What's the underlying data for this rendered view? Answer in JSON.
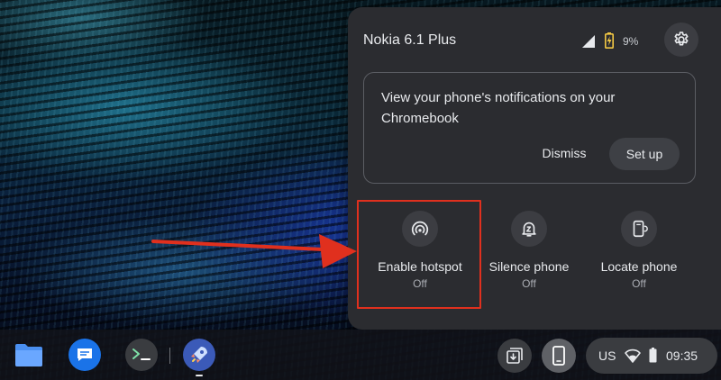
{
  "colors": {
    "panel_bg": "#2b2c30",
    "accent_highlight": "#e0301e",
    "battery_charging": "#f2c744",
    "text_primary": "#e8eaed",
    "text_secondary": "#a9acb2"
  },
  "phone_hub": {
    "device_name": "Nokia 6.1 Plus",
    "signal_icon": "cell-signal-icon",
    "battery_icon": "battery-charging-icon",
    "battery_percent": "9%",
    "settings_icon": "gear-icon",
    "notification_card": {
      "message": "View your phone's notifications on your Chromebook",
      "dismiss_label": "Dismiss",
      "setup_label": "Set up"
    },
    "features": [
      {
        "label": "Enable hotspot",
        "state": "Off",
        "icon": "hotspot-icon"
      },
      {
        "label": "Silence phone",
        "state": "Off",
        "icon": "silence-bell-icon"
      },
      {
        "label": "Locate phone",
        "state": "Off",
        "icon": "locate-phone-icon"
      }
    ]
  },
  "shelf": {
    "apps": [
      {
        "name": "Files",
        "icon": "folder-icon"
      },
      {
        "name": "Messages",
        "icon": "messages-icon"
      },
      {
        "name": "Terminal",
        "icon": "terminal-icon"
      },
      {
        "name": "Launcher app",
        "icon": "rocket-icon"
      }
    ],
    "tray": {
      "holding_space_icon": "holding-space-icon",
      "phone_hub_icon": "phone-icon",
      "keyboard_language": "US",
      "wifi_icon": "wifi-icon",
      "battery_icon": "battery-icon",
      "time": "09:35"
    }
  }
}
